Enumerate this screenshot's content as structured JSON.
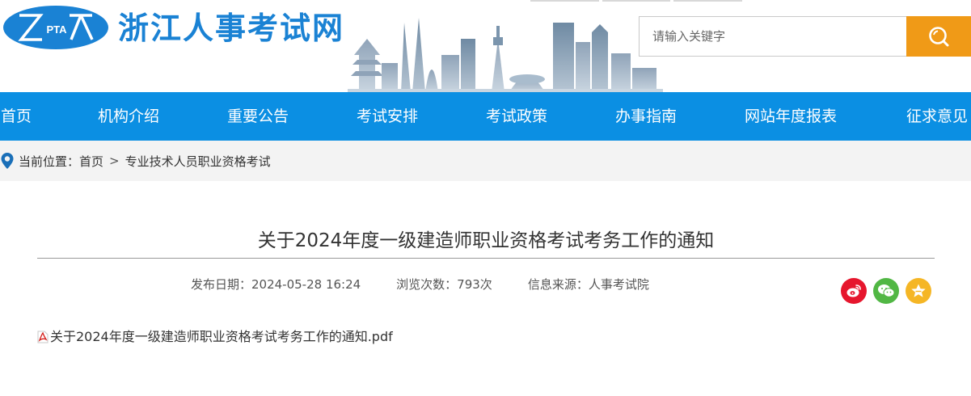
{
  "header": {
    "logo_text": "PTA",
    "site_title": "浙江人事考试网",
    "search_placeholder": "请输入关键字"
  },
  "nav": {
    "items": [
      "首页",
      "机构介绍",
      "重要公告",
      "考试安排",
      "考试政策",
      "办事指南",
      "网站年度报表",
      "征求意见"
    ]
  },
  "breadcrumb": {
    "label": "当前位置：",
    "home": "首页",
    "separator": ">",
    "current": "专业技术人员职业资格考试"
  },
  "article": {
    "title": "关于2024年度一级建造师职业资格考试考务工作的通知",
    "publish_date": "发布日期：2024-05-28 16:24",
    "views": "浏览次数：793次",
    "source": "信息来源：人事考试院",
    "attachment": "关于2024年度一级建造师职业资格考试考务工作的通知.pdf"
  },
  "share": {
    "icons": [
      "weibo-icon",
      "wechat-icon",
      "star-icon"
    ]
  },
  "colors": {
    "brand_blue": "#0b8fe3",
    "title_blue": "#1a82d4",
    "search_orange": "#f09a17",
    "weibo_red": "#e6162d",
    "wechat_green": "#51b744",
    "favorite_yellow": "#f5b625"
  }
}
